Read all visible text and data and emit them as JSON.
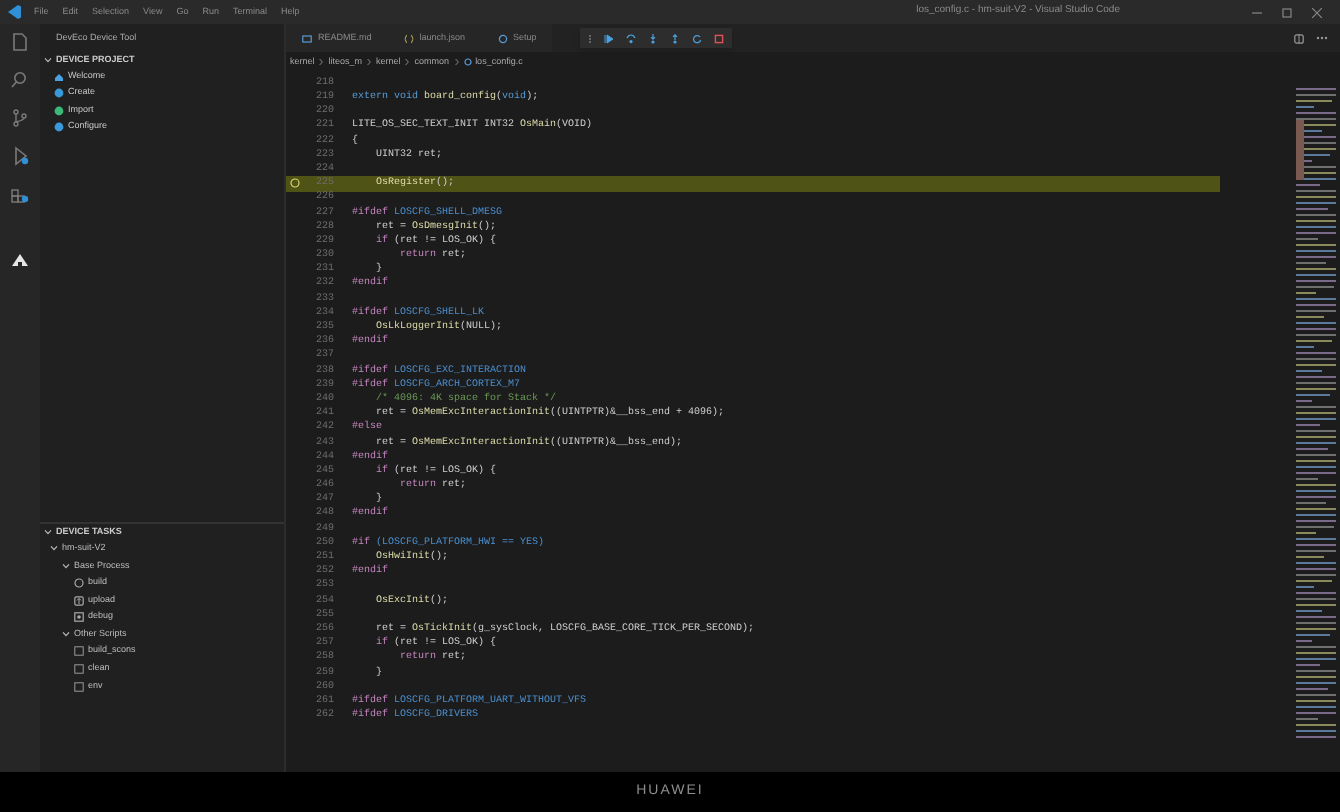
{
  "menu": [
    "File",
    "Edit",
    "Selection",
    "View",
    "Go",
    "Run",
    "Terminal",
    "Help"
  ],
  "window": {
    "title": "los_config.c - hm-suit-V2 - Visual Studio Code"
  },
  "activity_bar": [
    {
      "kind": "files",
      "selected": false
    },
    {
      "kind": "search",
      "selected": false
    },
    {
      "kind": "scm",
      "selected": false
    },
    {
      "kind": "debug",
      "selected": false
    },
    {
      "kind": "extensions",
      "selected": false
    },
    {
      "kind": "deveco",
      "selected": true
    }
  ],
  "sidebar": {
    "title": "DevEco Device Tool",
    "project": {
      "heading": "DEVICE PROJECT",
      "items": [
        {
          "label": "Welcome",
          "kind": "home"
        },
        {
          "label": "Create",
          "kind": "create"
        },
        {
          "label": "Import",
          "kind": "import"
        },
        {
          "label": "Configure",
          "kind": "configure"
        }
      ]
    },
    "tasks": {
      "heading": "DEVICE TASKS",
      "tree": [
        {
          "label": "hm-suit-V2",
          "expanded": true,
          "children": [
            {
              "label": "Base Process",
              "expanded": true,
              "children": [
                {
                  "label": "build",
                  "kind": "build"
                },
                {
                  "label": "upload",
                  "kind": "upload"
                },
                {
                  "label": "debug",
                  "kind": "debug"
                }
              ]
            },
            {
              "label": "Other Scripts",
              "expanded": true,
              "children": [
                {
                  "label": "build_scons",
                  "kind": "script"
                },
                {
                  "label": "clean",
                  "kind": "script"
                },
                {
                  "label": "env",
                  "kind": "script"
                }
              ]
            }
          ]
        }
      ]
    }
  },
  "tabs": [
    {
      "label": "README.md",
      "kind": "markdown",
      "selected": false
    },
    {
      "label": "launch.json",
      "kind": "json",
      "selected": false
    },
    {
      "label": "Setup",
      "kind": "settings",
      "selected": false
    }
  ],
  "debug_toolbar": [
    {
      "kind": "continue"
    },
    {
      "kind": "step-over"
    },
    {
      "kind": "step-into"
    },
    {
      "kind": "step-out"
    },
    {
      "kind": "restart"
    },
    {
      "kind": "stop"
    }
  ],
  "breadcrumb": [
    "kernel",
    "liteos_m",
    "kernel",
    "common",
    "los_config.c"
  ],
  "code": [
    {
      "number": "218"
    },
    {
      "number": "219",
      "tokens": [
        {
          "kind": "kw",
          "text": "extern void "
        },
        {
          "kind": "fn",
          "text": "board_config"
        },
        {
          "kind": "tx",
          "text": "("
        },
        {
          "kind": "kw",
          "text": "void"
        },
        {
          "kind": "tx",
          "text": ");"
        }
      ]
    },
    {
      "number": "220"
    },
    {
      "number": "221",
      "tokens": [
        {
          "kind": "tx",
          "text": "LITE_OS_SEC_TEXT_INIT INT32 "
        },
        {
          "kind": "fn",
          "text": "OsMain"
        },
        {
          "kind": "tx",
          "text": "(VOID)"
        }
      ]
    },
    {
      "number": "222",
      "tokens": [
        {
          "kind": "tx",
          "text": "{"
        }
      ]
    },
    {
      "number": "223",
      "tokens": [
        {
          "kind": "tx",
          "text": "    UINT32 ret;"
        }
      ]
    },
    {
      "number": "224"
    },
    {
      "number": "225",
      "highlighted": true,
      "tokens": [
        {
          "kind": "fn",
          "text": "    OsRegister"
        },
        {
          "kind": "tx",
          "text": "();"
        }
      ]
    },
    {
      "number": "226"
    },
    {
      "number": "227",
      "tokens": [
        {
          "kind": "pp",
          "text": "#ifdef "
        },
        {
          "kind": "macro",
          "text": "LOSCFG_SHELL_DMESG"
        }
      ]
    },
    {
      "number": "228",
      "tokens": [
        {
          "kind": "tx",
          "text": "    ret = "
        },
        {
          "kind": "fn",
          "text": "OsDmesgInit"
        },
        {
          "kind": "tx",
          "text": "();"
        }
      ]
    },
    {
      "number": "229",
      "tokens": [
        {
          "kind": "ctl",
          "text": "    if "
        },
        {
          "kind": "tx",
          "text": "(ret != LOS_OK) {"
        }
      ]
    },
    {
      "number": "230",
      "tokens": [
        {
          "kind": "ctl",
          "text": "        return "
        },
        {
          "kind": "tx",
          "text": "ret;"
        }
      ]
    },
    {
      "number": "231",
      "tokens": [
        {
          "kind": "tx",
          "text": "    }"
        }
      ]
    },
    {
      "number": "232",
      "tokens": [
        {
          "kind": "pp",
          "text": "#endif"
        }
      ]
    },
    {
      "number": "233"
    },
    {
      "number": "234",
      "tokens": [
        {
          "kind": "pp",
          "text": "#ifdef "
        },
        {
          "kind": "macro",
          "text": "LOSCFG_SHELL_LK"
        }
      ]
    },
    {
      "number": "235",
      "tokens": [
        {
          "kind": "fn",
          "text": "    OsLkLoggerInit"
        },
        {
          "kind": "tx",
          "text": "(NULL);"
        }
      ]
    },
    {
      "number": "236",
      "tokens": [
        {
          "kind": "pp",
          "text": "#endif"
        }
      ]
    },
    {
      "number": "237"
    },
    {
      "number": "238",
      "tokens": [
        {
          "kind": "pp",
          "text": "#ifdef "
        },
        {
          "kind": "macro",
          "text": "LOSCFG_EXC_INTERACTION"
        }
      ]
    },
    {
      "number": "239",
      "tokens": [
        {
          "kind": "pp",
          "text": "#ifdef "
        },
        {
          "kind": "macro",
          "text": "LOSCFG_ARCH_CORTEX_M7"
        }
      ]
    },
    {
      "number": "240",
      "tokens": [
        {
          "kind": "cm",
          "text": "    /* 4096: 4K space for Stack */"
        }
      ]
    },
    {
      "number": "241",
      "tokens": [
        {
          "kind": "tx",
          "text": "    ret = "
        },
        {
          "kind": "fn",
          "text": "OsMemExcInteractionInit"
        },
        {
          "kind": "tx",
          "text": "((UINTPTR)&__bss_end + 4096);"
        }
      ]
    },
    {
      "number": "242",
      "tokens": [
        {
          "kind": "pp",
          "text": "#else"
        }
      ]
    },
    {
      "number": "243",
      "tokens": [
        {
          "kind": "tx",
          "text": "    ret = "
        },
        {
          "kind": "fn",
          "text": "OsMemExcInteractionInit"
        },
        {
          "kind": "tx",
          "text": "((UINTPTR)&__bss_end);"
        }
      ]
    },
    {
      "number": "244",
      "tokens": [
        {
          "kind": "pp",
          "text": "#endif"
        }
      ]
    },
    {
      "number": "245",
      "tokens": [
        {
          "kind": "ctl",
          "text": "    if "
        },
        {
          "kind": "tx",
          "text": "(ret != LOS_OK) {"
        }
      ]
    },
    {
      "number": "246",
      "tokens": [
        {
          "kind": "ctl",
          "text": "        return "
        },
        {
          "kind": "tx",
          "text": "ret;"
        }
      ]
    },
    {
      "number": "247",
      "tokens": [
        {
          "kind": "tx",
          "text": "    }"
        }
      ]
    },
    {
      "number": "248",
      "tokens": [
        {
          "kind": "pp",
          "text": "#endif"
        }
      ]
    },
    {
      "number": "249"
    },
    {
      "number": "250",
      "tokens": [
        {
          "kind": "pp",
          "text": "#if "
        },
        {
          "kind": "macro",
          "text": "(LOSCFG_PLATFORM_HWI == YES)"
        }
      ]
    },
    {
      "number": "251",
      "tokens": [
        {
          "kind": "fn",
          "text": "    OsHwiInit"
        },
        {
          "kind": "tx",
          "text": "();"
        }
      ]
    },
    {
      "number": "252",
      "tokens": [
        {
          "kind": "pp",
          "text": "#endif"
        }
      ]
    },
    {
      "number": "253"
    },
    {
      "number": "254",
      "tokens": [
        {
          "kind": "fn",
          "text": "    OsExcInit"
        },
        {
          "kind": "tx",
          "text": "();"
        }
      ]
    },
    {
      "number": "255"
    },
    {
      "number": "256",
      "tokens": [
        {
          "kind": "tx",
          "text": "    ret = "
        },
        {
          "kind": "fn",
          "text": "OsTickInit"
        },
        {
          "kind": "tx",
          "text": "(g_sysClock, LOSCFG_BASE_CORE_TICK_PER_SECOND);"
        }
      ]
    },
    {
      "number": "257",
      "tokens": [
        {
          "kind": "ctl",
          "text": "    if "
        },
        {
          "kind": "tx",
          "text": "(ret != LOS_OK) {"
        }
      ]
    },
    {
      "number": "258",
      "tokens": [
        {
          "kind": "ctl",
          "text": "        return "
        },
        {
          "kind": "tx",
          "text": "ret;"
        }
      ]
    },
    {
      "number": "259",
      "tokens": [
        {
          "kind": "tx",
          "text": "    }"
        }
      ]
    },
    {
      "number": "260"
    },
    {
      "number": "261",
      "tokens": [
        {
          "kind": "pp",
          "text": "#ifdef "
        },
        {
          "kind": "macro",
          "text": "LOSCFG_PLATFORM_UART_WITHOUT_VFS"
        }
      ]
    },
    {
      "number": "262",
      "tokens": [
        {
          "kind": "pp",
          "text": "#ifdef "
        },
        {
          "kind": "macro",
          "text": "LOSCFG_DRIVERS"
        }
      ]
    }
  ],
  "footer": {
    "logo": "HUAWEI"
  }
}
